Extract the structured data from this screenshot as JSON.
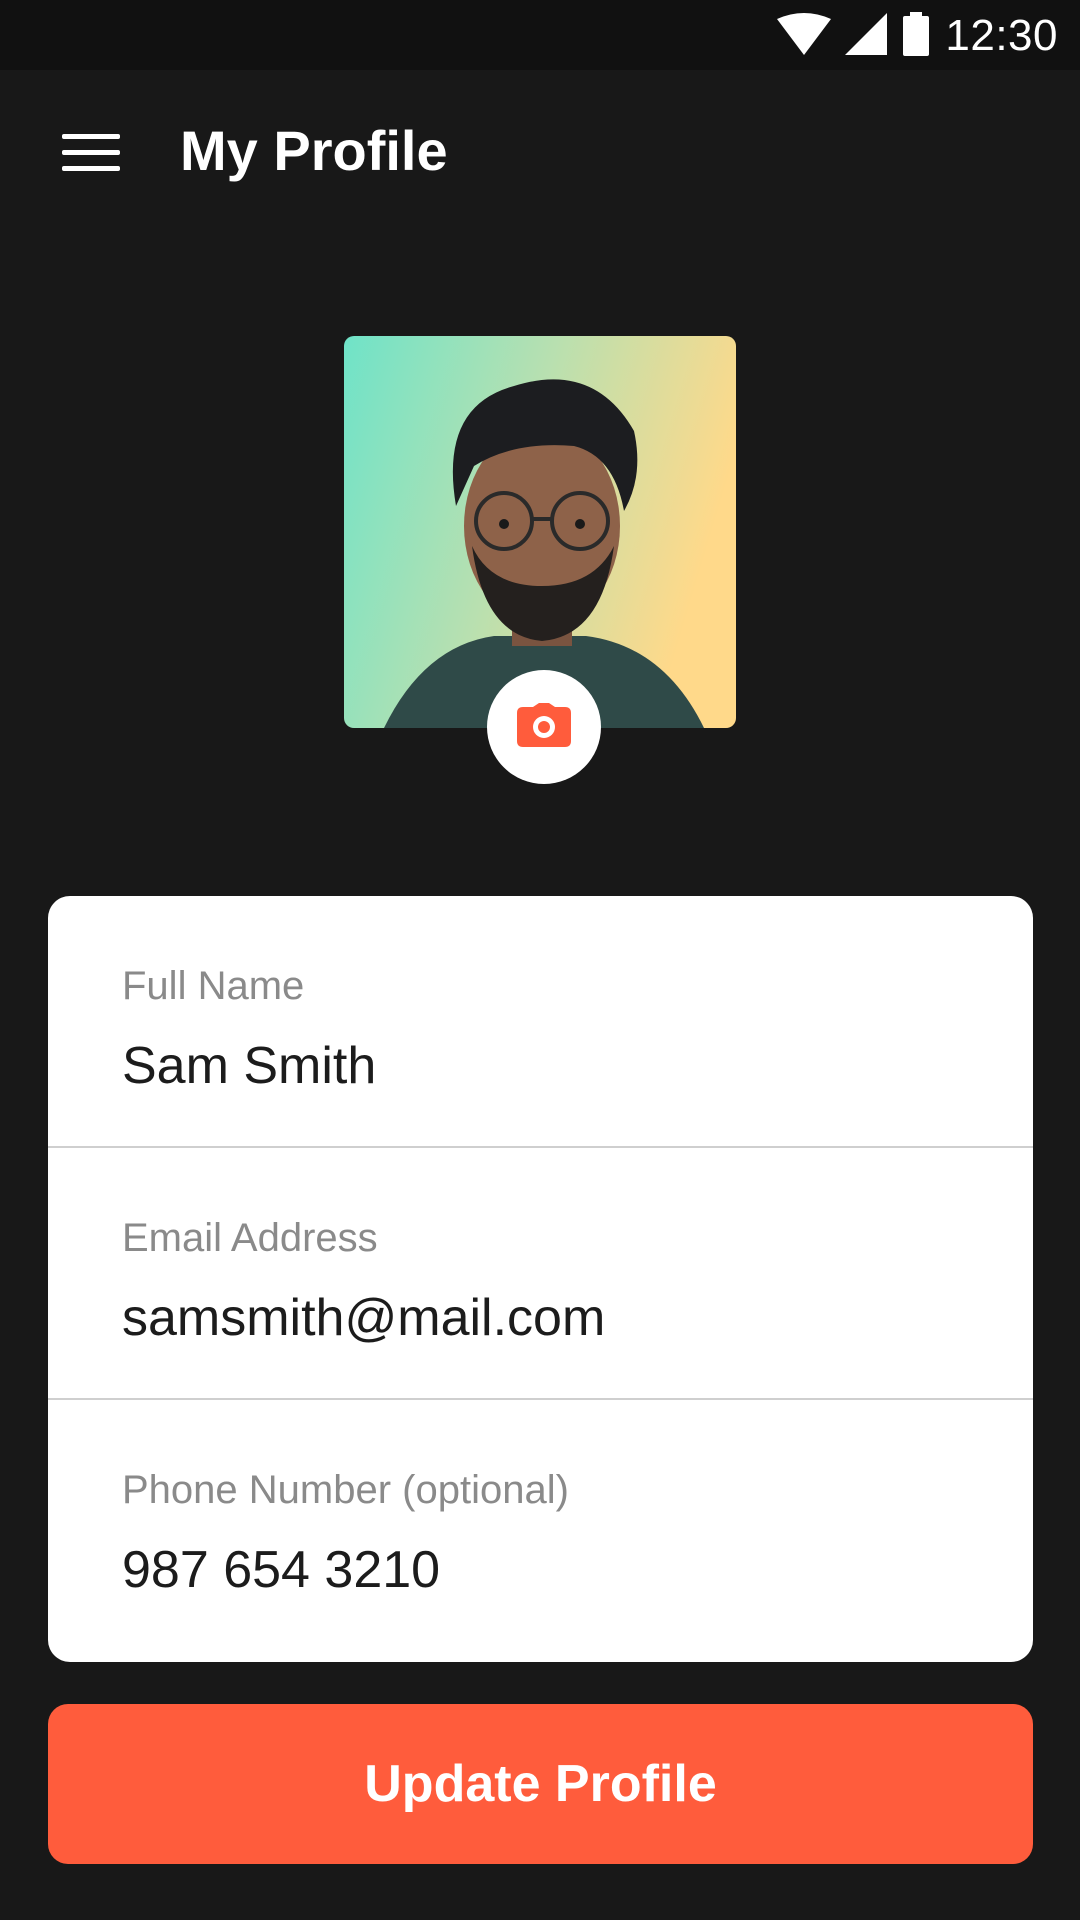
{
  "status_bar": {
    "time": "12:30",
    "icons": [
      "wifi-icon",
      "signal-icon",
      "battery-icon"
    ]
  },
  "app_bar": {
    "title": "My Profile",
    "menu_icon": "menu-icon"
  },
  "profile": {
    "camera_icon": "camera-icon"
  },
  "form": {
    "full_name": {
      "label": "Full Name",
      "value": "Sam Smith"
    },
    "email": {
      "label": "Email Address",
      "value": "samsmith@mail.com"
    },
    "phone": {
      "label": "Phone Number (optional)",
      "value": "987 654 3210"
    }
  },
  "actions": {
    "update_label": "Update Profile"
  },
  "colors": {
    "background": "#181818",
    "status_bar": "#111111",
    "accent": "#ff5c3c",
    "card": "#ffffff",
    "label": "#8a8a8a",
    "value": "#1c1c1c"
  }
}
